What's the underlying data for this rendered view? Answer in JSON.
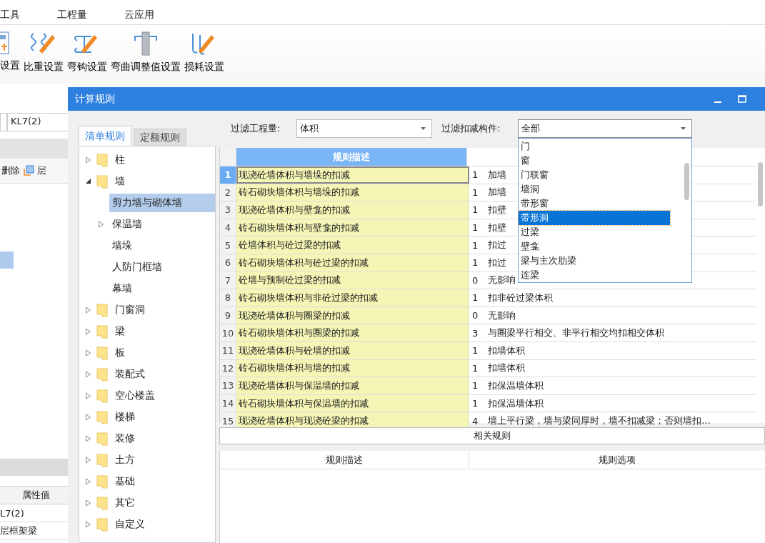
{
  "menu": [
    "工具",
    "工程量",
    "云应用"
  ],
  "ribbon": [
    {
      "label": "设置",
      "kind": "document"
    },
    {
      "label": "比重设置",
      "kind": "spring"
    },
    {
      "label": "弯钩设置",
      "kind": "hook"
    },
    {
      "label": "弯曲调整值设置",
      "kind": "column"
    },
    {
      "label": "损耗设置",
      "kind": "bend"
    }
  ],
  "background_panel": {
    "component_field": "KL7(2)",
    "toolbar": [
      "删除",
      "层"
    ],
    "properties_header": "属性值",
    "property_rows": [
      "L7(2)",
      "层框架梁"
    ]
  },
  "dialog": {
    "title": "计算规则",
    "tabs": [
      {
        "label": "清单规则",
        "selected": true
      },
      {
        "label": "定额规则",
        "selected": false
      }
    ],
    "tree": [
      {
        "label": "柱",
        "expandable": true,
        "expanded": false,
        "selected": false
      },
      {
        "label": "墙",
        "expandable": true,
        "expanded": true,
        "selected": false,
        "children": [
          {
            "label": "剪力墙与砌体墙",
            "expandable": false,
            "selected": true
          },
          {
            "label": "保温墙",
            "expandable": true,
            "expanded": false,
            "selected": false
          },
          {
            "label": "墙垛",
            "expandable": false,
            "selected": false
          },
          {
            "label": "人防门框墙",
            "expandable": false,
            "selected": false
          },
          {
            "label": "幕墙",
            "expandable": false,
            "selected": false
          }
        ]
      },
      {
        "label": "门窗洞",
        "expandable": true,
        "expanded": false,
        "selected": false
      },
      {
        "label": "梁",
        "expandable": true,
        "expanded": false,
        "selected": false
      },
      {
        "label": "板",
        "expandable": true,
        "expanded": false,
        "selected": false
      },
      {
        "label": "装配式",
        "expandable": true,
        "expanded": false,
        "selected": false
      },
      {
        "label": "空心楼盖",
        "expandable": true,
        "expanded": false,
        "selected": false
      },
      {
        "label": "楼梯",
        "expandable": true,
        "expanded": false,
        "selected": false
      },
      {
        "label": "装修",
        "expandable": true,
        "expanded": false,
        "selected": false
      },
      {
        "label": "土方",
        "expandable": true,
        "expanded": false,
        "selected": false
      },
      {
        "label": "基础",
        "expandable": true,
        "expanded": false,
        "selected": false
      },
      {
        "label": "其它",
        "expandable": true,
        "expanded": false,
        "selected": false
      },
      {
        "label": "自定义",
        "expandable": true,
        "expanded": false,
        "selected": false
      }
    ],
    "filters": [
      {
        "label": "过滤工程量:",
        "value": "体积"
      },
      {
        "label": "过滤扣减构件:",
        "value": "全部",
        "open": true,
        "options": [
          {
            "label": "门",
            "selected": false
          },
          {
            "label": "窗",
            "selected": false
          },
          {
            "label": "门联窗",
            "selected": false
          },
          {
            "label": "墙洞",
            "selected": false
          },
          {
            "label": "带形窗",
            "selected": false
          },
          {
            "label": "带形洞",
            "selected": true
          },
          {
            "label": "过梁",
            "selected": false
          },
          {
            "label": "壁龛",
            "selected": false
          },
          {
            "label": "梁与主次肋梁",
            "selected": false
          },
          {
            "label": "连梁",
            "selected": false
          }
        ]
      }
    ],
    "rules_table": {
      "columns": [
        "规则描述"
      ],
      "rows": [
        {
          "num": "1",
          "description": "现浇砼墙体积与墙垛的扣减",
          "code": "1",
          "option": "加墙",
          "selected": true
        },
        {
          "num": "2",
          "description": "砖石砌块墙体积与墙垛的扣减",
          "code": "1",
          "option": "加墙",
          "selected": false
        },
        {
          "num": "3",
          "description": "现浇砼墙体积与壁龛的扣减",
          "code": "1",
          "option": "扣壁",
          "selected": false
        },
        {
          "num": "4",
          "description": "砖石砌块墙体积与壁龛的扣减",
          "code": "1",
          "option": "扣壁",
          "selected": false
        },
        {
          "num": "5",
          "description": "砼墙体积与砼过梁的扣减",
          "code": "1",
          "option": "扣过",
          "selected": false
        },
        {
          "num": "6",
          "description": "砖石砌块墙体积与砼过梁的扣减",
          "code": "1",
          "option": "扣过",
          "selected": false
        },
        {
          "num": "7",
          "description": "砼墙与预制砼过梁的扣减",
          "code": "0",
          "option": "无影响",
          "selected": false
        },
        {
          "num": "8",
          "description": "砖石砌块墙体积与非砼过梁的扣减",
          "code": "1",
          "option": "扣非砼过梁体积",
          "selected": false
        },
        {
          "num": "9",
          "description": "现浇砼墙体积与圈梁的扣减",
          "code": "0",
          "option": "无影响",
          "selected": false
        },
        {
          "num": "10",
          "description": "砖石砌块墙体积与圈梁的扣减",
          "code": "3",
          "option": "与圈梁平行相交、非平行相交均扣相交体积",
          "selected": false
        },
        {
          "num": "11",
          "description": "现浇砼墙体积与砼墙的扣减",
          "code": "1",
          "option": "扣墙体积",
          "selected": false
        },
        {
          "num": "12",
          "description": "砖石砌块墙体积与墙的扣减",
          "code": "1",
          "option": "扣墙体积",
          "selected": false
        },
        {
          "num": "13",
          "description": "现浇砼墙体积与保温墙的扣减",
          "code": "1",
          "option": "扣保温墙体积",
          "selected": false
        },
        {
          "num": "14",
          "description": "砖石砌块墙体积与保温墙的扣减",
          "code": "1",
          "option": "扣保温墙体积",
          "selected": false
        },
        {
          "num": "15",
          "description": "现浇砼墙体积与现浇砼梁的扣减",
          "code": "4",
          "option": "墙上平行梁，墙与梁同厚时，墙不扣减梁；否则墙扣…",
          "selected": false
        }
      ]
    },
    "related_rules": {
      "title": "相关规则",
      "columns": [
        "规则描述",
        "规则选项"
      ]
    }
  }
}
